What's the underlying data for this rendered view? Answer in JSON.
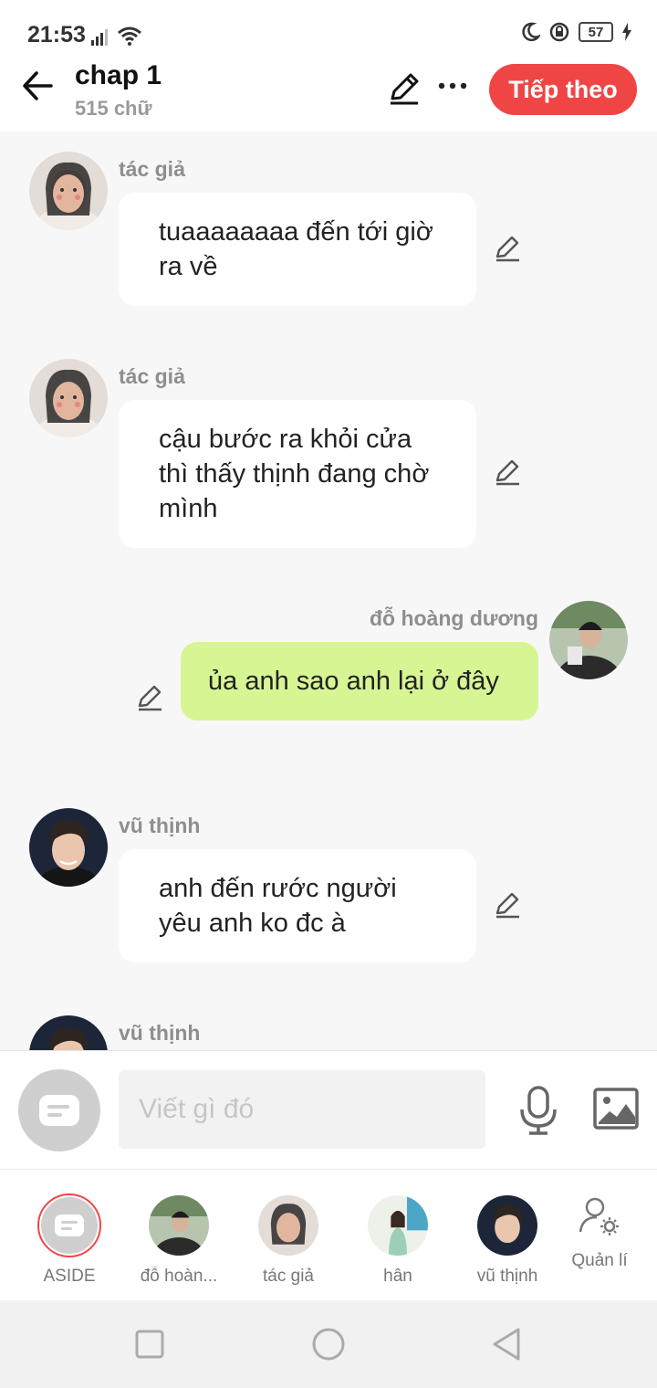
{
  "status_bar": {
    "time": "21:53",
    "battery": "57"
  },
  "header": {
    "title": "chap 1",
    "word_count": "515 chữ",
    "next_label": "Tiếp theo"
  },
  "messages": [
    {
      "sender": "tác giả",
      "text": "tuaaaaaaaa đến tới giờ ra về",
      "side": "left"
    },
    {
      "sender": "tác giả",
      "text": "cậu bước ra khỏi cửa thì thấy thịnh đang chờ mình",
      "side": "left"
    },
    {
      "sender": "đỗ hoàng dương",
      "text": "ủa anh sao anh lại ở đây",
      "side": "right"
    },
    {
      "sender": "vũ thịnh",
      "text": "anh đến rước người yêu anh ko đc à",
      "side": "left"
    },
    {
      "sender": "vũ thịnh",
      "text": "",
      "side": "left"
    }
  ],
  "composer": {
    "placeholder": "Viết gì đó"
  },
  "characters": [
    {
      "label": "ASIDE"
    },
    {
      "label": "đỗ hoàn..."
    },
    {
      "label": "tác giả"
    },
    {
      "label": "hân"
    },
    {
      "label": "vũ thịnh"
    }
  ],
  "manage_label": "Quản lí",
  "colors": {
    "accent": "#f04545",
    "my_bubble": "#d8f594",
    "bubble": "#ffffff",
    "background": "#f7f7f7"
  }
}
